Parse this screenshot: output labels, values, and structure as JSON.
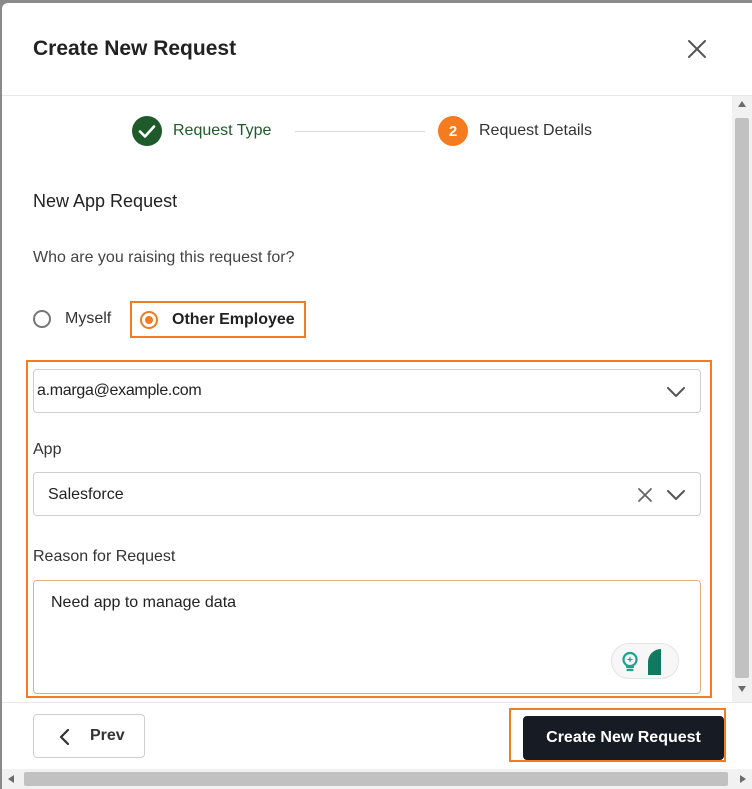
{
  "dialog": {
    "title": "Create New Request",
    "close_icon": "close-icon"
  },
  "stepper": {
    "steps": [
      {
        "label": "Request Type",
        "status": "completed",
        "icon": "check-icon"
      },
      {
        "number": "2",
        "label": "Request Details",
        "status": "active"
      }
    ],
    "colors": {
      "completed": "#1f5a2a",
      "active": "#f47b20"
    }
  },
  "form": {
    "section_title": "New App Request",
    "question": "Who are you raising this request for?",
    "radio_options": [
      {
        "label": "Myself",
        "selected": false
      },
      {
        "label": "Other Employee",
        "selected": true
      }
    ],
    "employee_value": "a.marga@example.com",
    "app_label": "App",
    "app_value": "Salesforce",
    "reason_label": "Reason for Request",
    "reason_value": "Need app to manage data"
  },
  "footer": {
    "prev_label": "Prev",
    "create_label": "Create New Request"
  },
  "highlight_color": "#f47b20"
}
